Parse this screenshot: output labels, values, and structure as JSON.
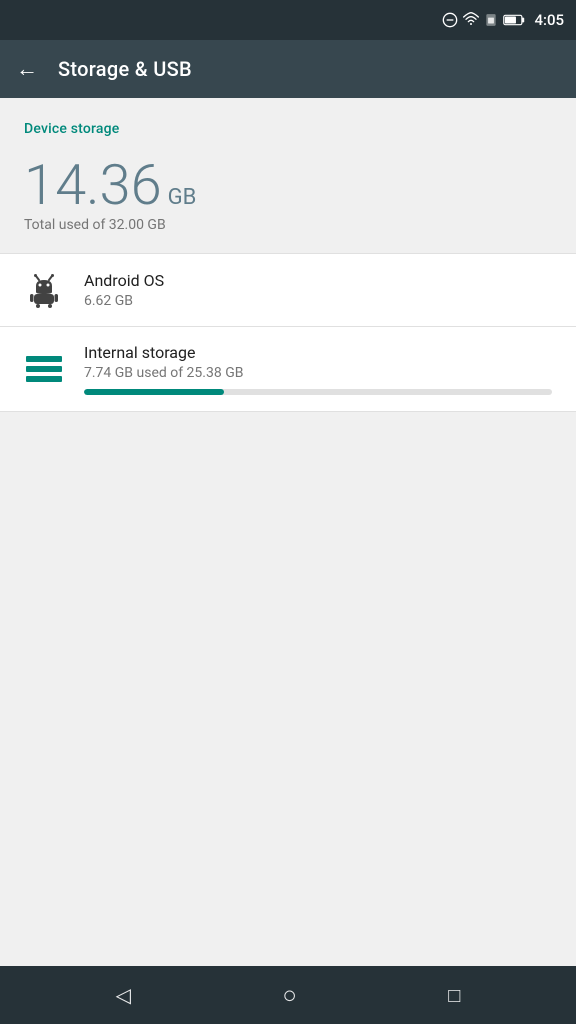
{
  "status_bar": {
    "time": "4:05",
    "icons": [
      "minus-circle-icon",
      "wifi-icon",
      "sim-icon",
      "battery-icon"
    ]
  },
  "top_bar": {
    "title": "Storage & USB",
    "back_label": "←"
  },
  "device_storage": {
    "section_label": "Device storage",
    "used_amount": "14.36",
    "used_unit": "GB",
    "total_text": "Total used of 32.00 GB",
    "internal_storage_percent": 30
  },
  "list_items": [
    {
      "title": "Android OS",
      "subtitle": "6.62 GB",
      "icon": "android-icon",
      "has_progress": false
    },
    {
      "title": "Internal storage",
      "subtitle": "7.74 GB used of 25.38 GB",
      "icon": "internal-storage-icon",
      "has_progress": true,
      "progress_percent": 30
    }
  ],
  "bottom_nav": {
    "back_label": "◁",
    "home_label": "○",
    "recents_label": "□"
  }
}
